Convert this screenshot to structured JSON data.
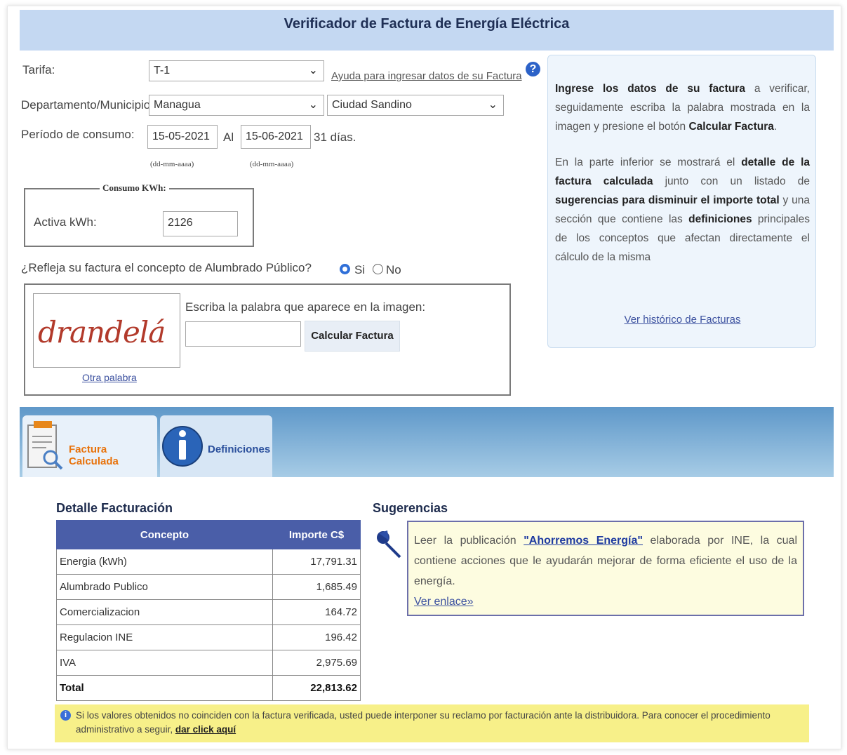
{
  "header": {
    "title": "Verificador de Factura de Energía Eléctrica"
  },
  "form": {
    "tarifa_label": "Tarifa:",
    "tarifa_value": "T-1",
    "ayuda_link": "Ayuda para ingresar datos de su Factura",
    "depto_label": "Departamento/Municipio:",
    "depto_value": "Managua",
    "municipio_value": "Ciudad Sandino",
    "periodo_label": "Período de consumo:",
    "fecha_inicio": "15-05-2021",
    "al_label": "Al",
    "fecha_fin": "15-06-2021",
    "dias_text": "31 días.",
    "fecha_hint_1": "(dd-mm-aaaa)",
    "fecha_hint_2": "(dd-mm-aaaa)",
    "consumo_legend": "Consumo KWh:",
    "activa_label": "Activa kWh:",
    "activa_value": "2126",
    "alumbrado_question": "¿Refleja su factura el concepto de Alumbrado Público?",
    "radio_si": "Si",
    "radio_no": "No",
    "radio_selected": "Si",
    "captcha_image_text": "drandelá",
    "captcha_instruction": "Escriba la palabra que aparece en la imagen:",
    "captcha_input_value": "",
    "calcular_button": "Calcular Factura",
    "otra_palabra_link": "Otra palabra"
  },
  "info_panel": {
    "p1_bold_a": "Ingrese los datos de su factura",
    "p1_text_a": " a verificar, seguidamente escriba la palabra mostrada en la imagen y presione el botón ",
    "p1_bold_b": "Calcular Factura",
    "p1_text_b": ".",
    "p2_text_a": "En la parte inferior se mostrará el ",
    "p2_bold_a": "detalle de la factura calculada",
    "p2_text_b": " junto con un listado de ",
    "p2_bold_b": "sugerencias para disminuir el importe total",
    "p2_text_c": " y una sección que contiene las ",
    "p2_bold_c": "definiciones",
    "p2_text_d": " principales de los conceptos que afectan directamente el cálculo de la misma",
    "historico_link": "Ver histórico de Facturas"
  },
  "tabs": [
    {
      "label": "Factura Calculada",
      "icon": "invoice-icon",
      "color": "#e8730c"
    },
    {
      "label": "Definiciones",
      "icon": "info-icon",
      "color": "#2a4f9c"
    }
  ],
  "detalle": {
    "title": "Detalle Facturación",
    "headers": [
      "Concepto",
      "Importe C$"
    ],
    "rows": [
      {
        "concepto": "Energia (kWh)",
        "importe": "17,791.31"
      },
      {
        "concepto": "Alumbrado Publico",
        "importe": "1,685.49"
      },
      {
        "concepto": "Comercializacion",
        "importe": "164.72"
      },
      {
        "concepto": "Regulacion INE",
        "importe": "196.42"
      },
      {
        "concepto": "IVA",
        "importe": "2,975.69"
      }
    ],
    "total_label": "Total",
    "total_value": "22,813.62"
  },
  "sugerencias": {
    "title": "Sugerencias",
    "text_a": "Leer la publicación ",
    "publication": "\"Ahorremos Energía\"",
    "text_b": " elaborada por INE, la cual contiene acciones que le ayudarán mejorar de forma eficiente el uso de la energía.",
    "link": "Ver enlace»"
  },
  "notice": {
    "text": "Si los valores obtenidos no coinciden con la factura verificada, usted puede interponer su reclamo por facturación ante la distribuidora. Para conocer el procedimiento administrativo a seguir, ",
    "link": "dar click aquí"
  },
  "colors": {
    "header_bg": "#c4d8f2",
    "table_header": "#4a5ea8",
    "suggestion_bg": "#fdfce0",
    "notice_bg": "#f7f089"
  }
}
